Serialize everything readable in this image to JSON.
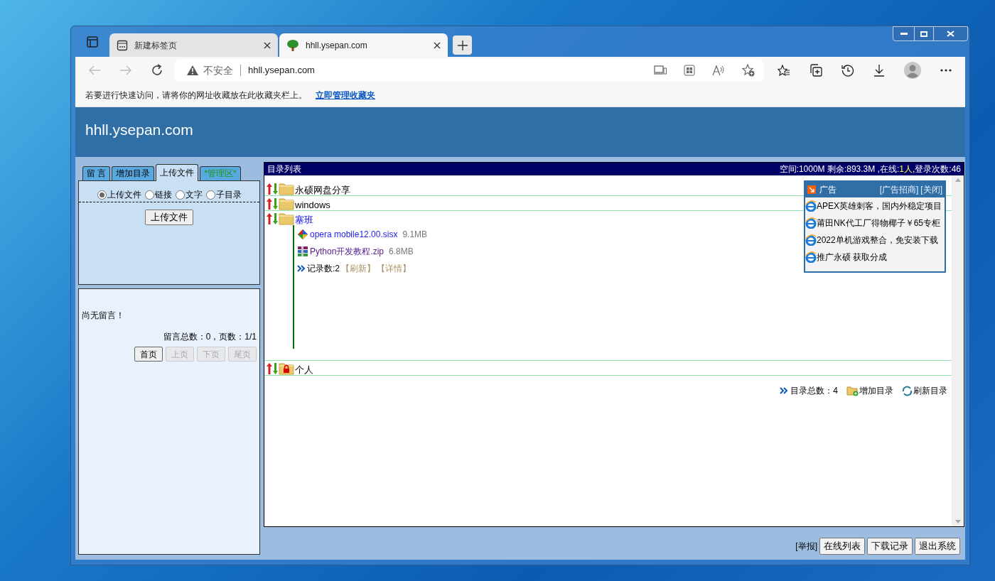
{
  "browser": {
    "tabs": [
      {
        "title": "新建标签页",
        "selected": false
      },
      {
        "title": "hhll.ysepan.com",
        "selected": true
      }
    ],
    "security_label": "不安全",
    "address": "hhll.ysepan.com",
    "favorites_hint": "若要进行快速访问，请将你的网址收藏放在此收藏夹栏上。",
    "favorites_link": "立即管理收藏夹"
  },
  "page": {
    "site_title": "hhll.ysepan.com",
    "side_tabs": [
      {
        "label": "留 言",
        "selected": false,
        "kind": "normal"
      },
      {
        "label": "增加目录",
        "selected": false,
        "kind": "normal"
      },
      {
        "label": "上传文件",
        "selected": true,
        "kind": "normal"
      },
      {
        "label": "*管理区*",
        "selected": false,
        "kind": "admin"
      }
    ],
    "upload_options": [
      {
        "label": "上传文件",
        "selected": true
      },
      {
        "label": "链接",
        "selected": false
      },
      {
        "label": "文字",
        "selected": false
      },
      {
        "label": "子目录",
        "selected": false
      }
    ],
    "upload_button": "上传文件",
    "message_empty": "尚无留言！",
    "message_stats": "留言总数：0，页数：1/1",
    "pager": [
      {
        "label": "首页",
        "disabled": false
      },
      {
        "label": "上页",
        "disabled": true
      },
      {
        "label": "下页",
        "disabled": true
      },
      {
        "label": "尾页",
        "disabled": true
      }
    ],
    "list_title": "目录列表",
    "stats_space": "空间:1000M 剩余:893.3M ,在线:",
    "stats_online": "1人",
    "stats_logins": ",登录次数:46",
    "folders": [
      {
        "name": "永硕网盘分享",
        "locked": false,
        "expanded": false
      },
      {
        "name": "windows",
        "locked": false,
        "expanded": false
      },
      {
        "name": "塞班",
        "locked": false,
        "expanded": true,
        "files": [
          {
            "name": "opera mobile12.00.sisx",
            "size": "9.1MB",
            "kind": "installer"
          },
          {
            "name": "Python开发教程.zip",
            "size": "6.8MB",
            "kind": "archive"
          }
        ],
        "record_count": "记录数:2",
        "actions": [
          "【刷新】",
          "【详情】"
        ]
      },
      {
        "name": "个人",
        "locked": true,
        "expanded": false
      }
    ],
    "summary": "目录总数：4",
    "footer_actions": [
      {
        "label": "增加目录",
        "kind": "add"
      },
      {
        "label": "刷新目录",
        "kind": "refresh"
      }
    ],
    "ad": {
      "title": "广告",
      "links": [
        "[广告招商]",
        "[关闭]"
      ],
      "items": [
        "APEX英雄刺客，国内外稳定项目",
        "莆田NK代工厂得物椰子￥65专柜",
        "2022单机游戏整合，免安装下载",
        "推广永硕 获取分成"
      ]
    },
    "report": "[举报]",
    "bottom_buttons": [
      "在线列表",
      "下载记录",
      "退出系统"
    ]
  }
}
